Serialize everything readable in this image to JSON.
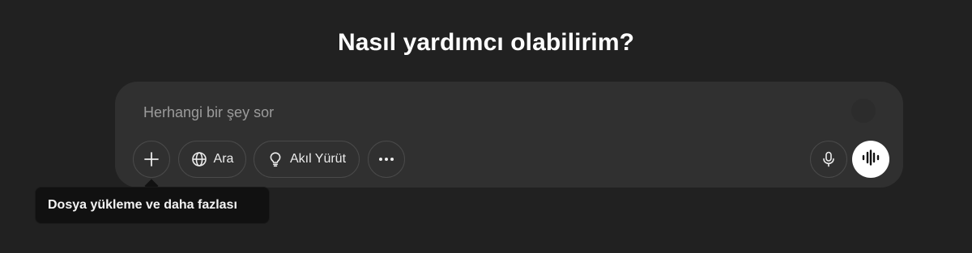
{
  "heading": "Nasıl yardımcı olabilirim?",
  "composer": {
    "placeholder": "Herhangi bir şey sor",
    "value": ""
  },
  "toolbar": {
    "attach_icon": "plus-icon",
    "search": {
      "label": "Ara",
      "icon": "globe-icon"
    },
    "reason": {
      "label": "Akıl Yürüt",
      "icon": "lightbulb-icon"
    },
    "more_icon": "more-dots-icon",
    "mic_icon": "microphone-icon",
    "voice_icon": "voice-wave-icon"
  },
  "tooltip": {
    "text": "Dosya yükleme ve daha fazlası"
  },
  "colors": {
    "background": "#212121",
    "composer": "#303030",
    "tooltip": "#111111",
    "voice_button": "#ffffff"
  }
}
